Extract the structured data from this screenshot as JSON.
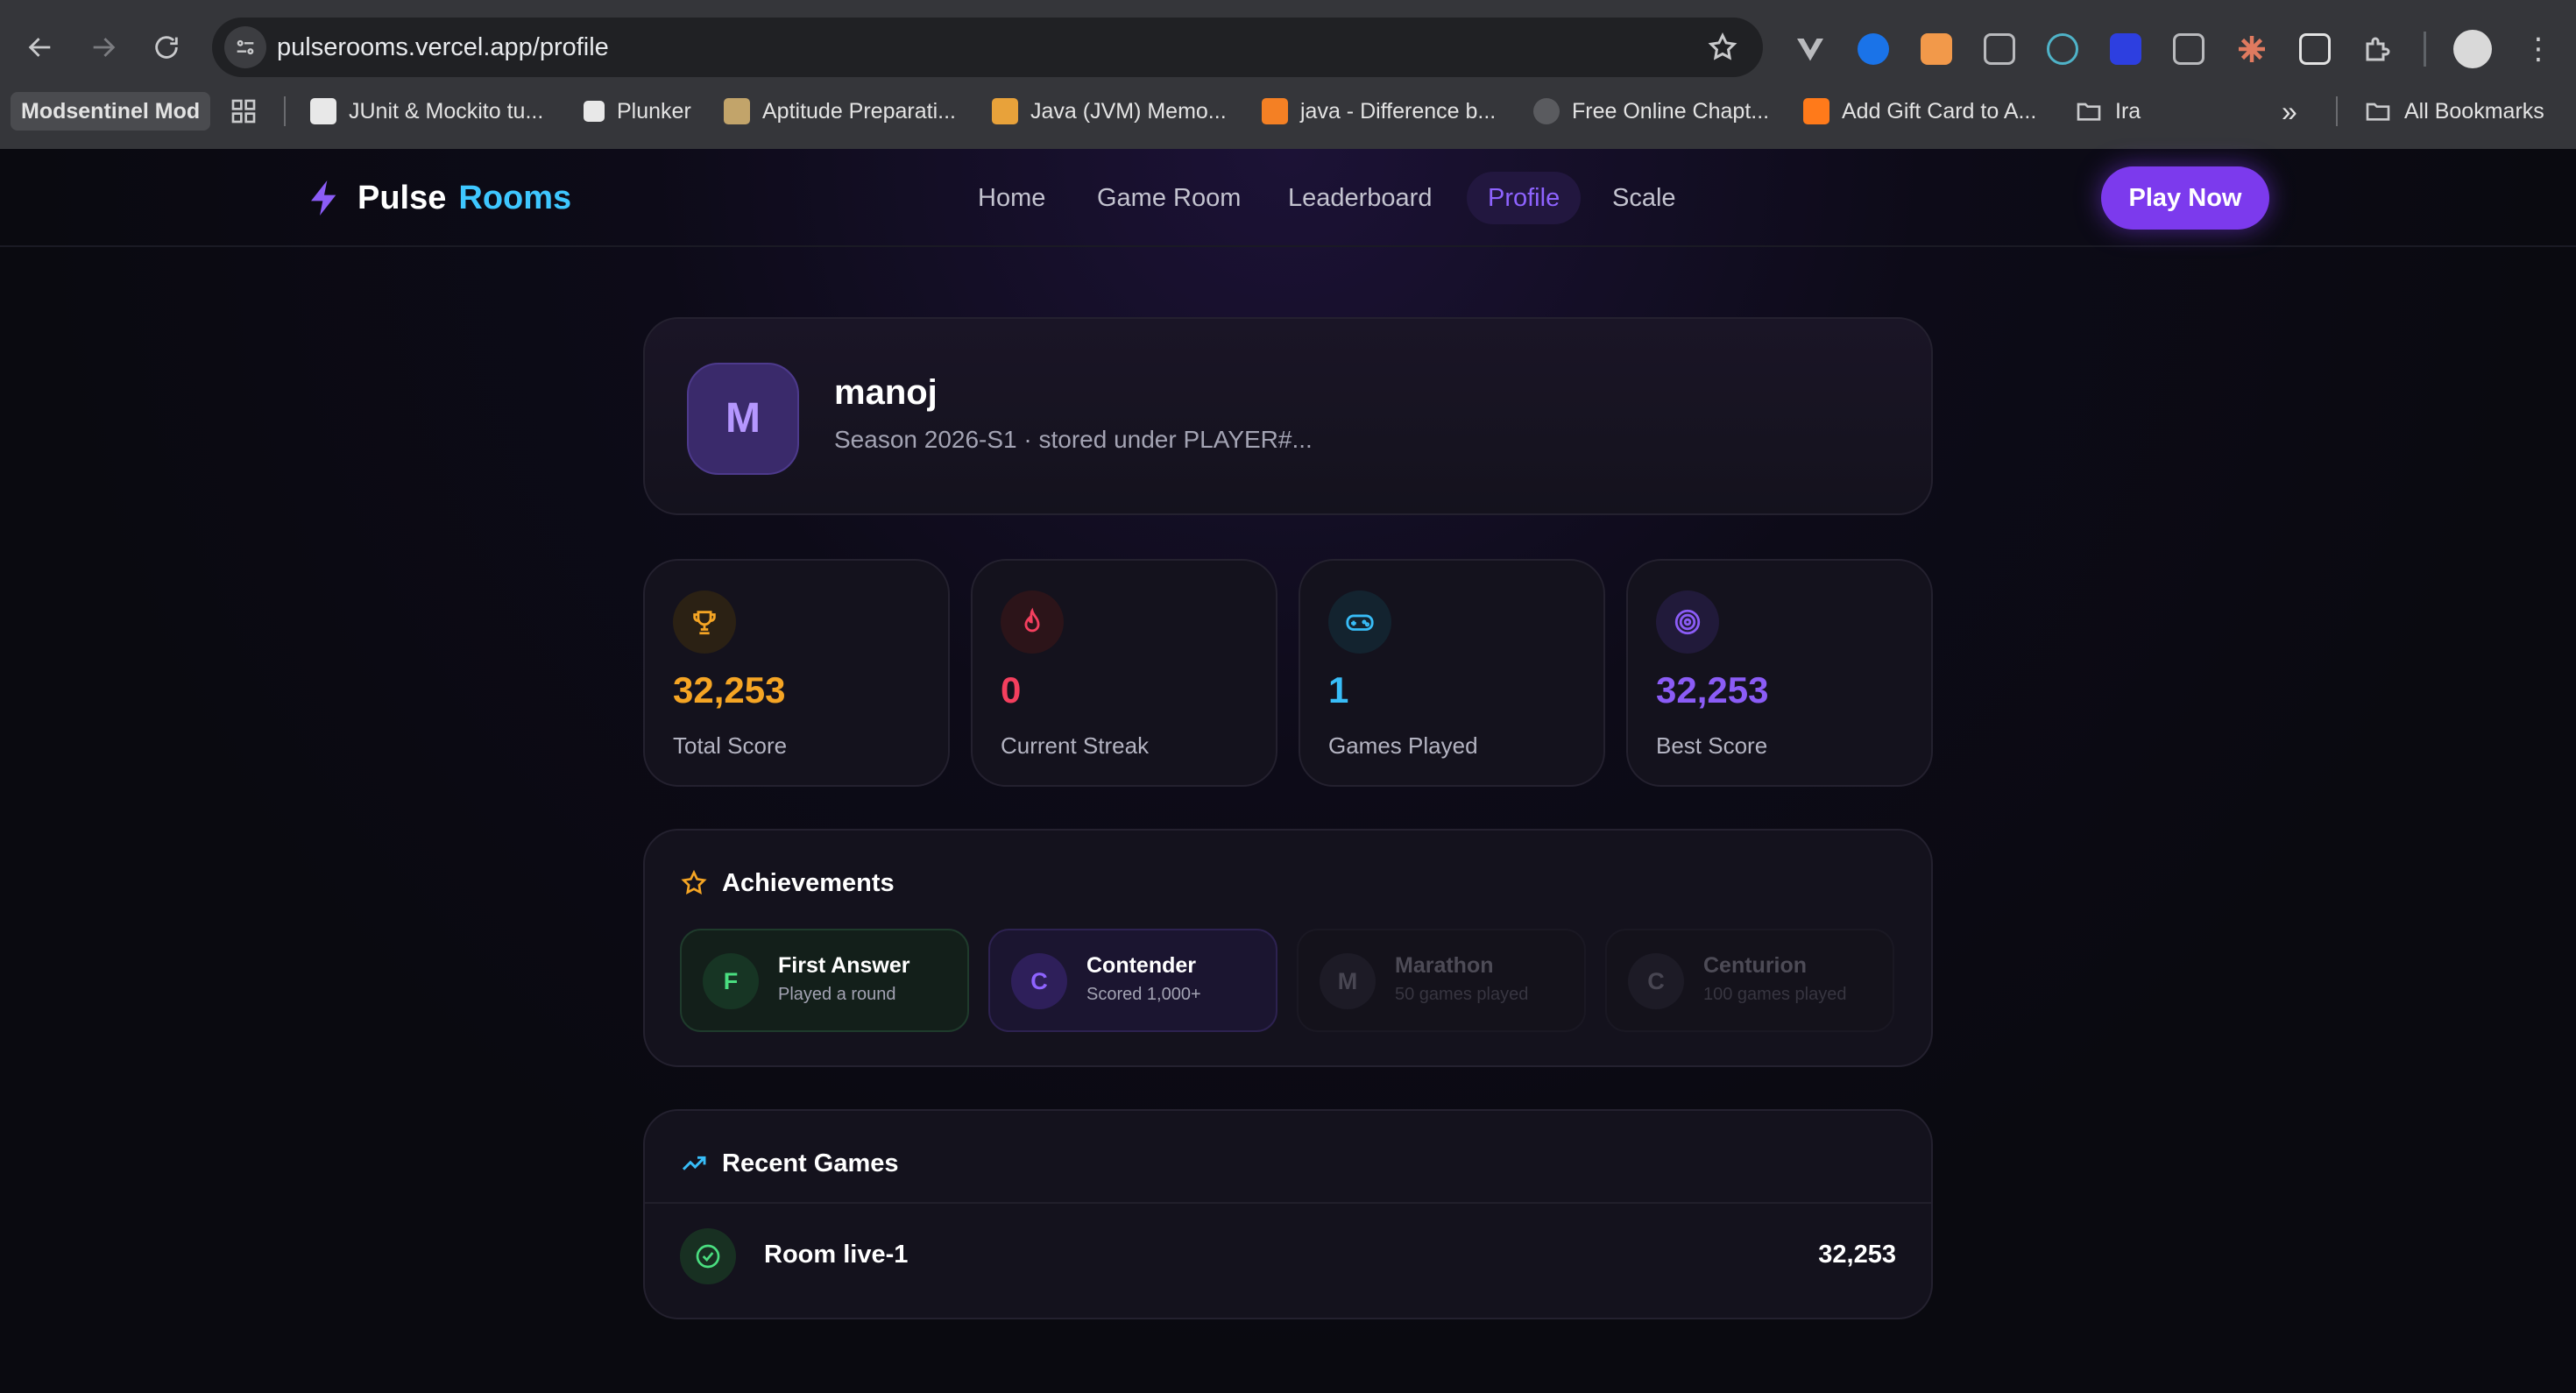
{
  "browser": {
    "url": "pulserooms.vercel.app/profile",
    "bookmarks": [
      {
        "label": "Modsentinel Mod"
      },
      {
        "label": "JUnit & Mockito tu..."
      },
      {
        "label": "Plunker"
      },
      {
        "label": "Aptitude Preparati..."
      },
      {
        "label": "Java (JVM) Memo..."
      },
      {
        "label": "java - Difference b..."
      },
      {
        "label": "Free Online Chapt..."
      },
      {
        "label": "Add Gift Card to A..."
      },
      {
        "label": "Ira"
      }
    ],
    "all_bookmarks": "All Bookmarks"
  },
  "header": {
    "brand_word1": "Pulse",
    "brand_word2": "Rooms",
    "nav": [
      "Home",
      "Game Room",
      "Leaderboard",
      "Profile",
      "Scale"
    ],
    "active_nav": "Profile",
    "cta": "Play Now"
  },
  "profile": {
    "initial": "M",
    "name": "manoj",
    "subtitle": "Season 2026-S1 · stored under PLAYER#..."
  },
  "stats": [
    {
      "value": "32,253",
      "label": "Total Score",
      "icon": "trophy-icon",
      "color": "#f5a524"
    },
    {
      "value": "0",
      "label": "Current Streak",
      "icon": "flame-icon",
      "color": "#f43f5e"
    },
    {
      "value": "1",
      "label": "Games Played",
      "icon": "gamepad-icon",
      "color": "#38bdf8"
    },
    {
      "value": "32,253",
      "label": "Best Score",
      "icon": "target-icon",
      "color": "#8b5cf6"
    }
  ],
  "achievements": {
    "title": "Achievements",
    "items": [
      {
        "initial": "F",
        "title": "First Answer",
        "subtitle": "Played a round",
        "state": "unlocked-green"
      },
      {
        "initial": "C",
        "title": "Contender",
        "subtitle": "Scored 1,000+",
        "state": "unlocked-purple"
      },
      {
        "initial": "M",
        "title": "Marathon",
        "subtitle": "50 games played",
        "state": "locked"
      },
      {
        "initial": "C",
        "title": "Centurion",
        "subtitle": "100 games played",
        "state": "locked"
      }
    ]
  },
  "recent": {
    "title": "Recent Games",
    "rows": [
      {
        "name": "Room live-1",
        "score": "32,253"
      }
    ]
  },
  "colors": {
    "accent": "#7c3aed",
    "brand_cyan": "#3ec7ff",
    "background": "#0a0a10"
  }
}
